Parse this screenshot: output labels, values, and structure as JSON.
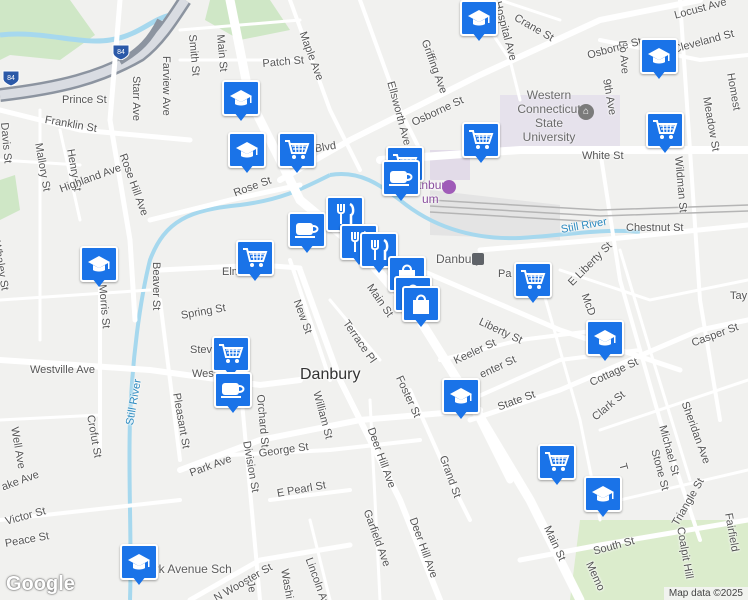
{
  "map": {
    "city_label": "Danbury",
    "attribution": "Map data ©2025",
    "logo": "Google",
    "highway_shield": "84",
    "streets": {
      "locust_ave": "Locust Ave",
      "crane_st": "Crane St",
      "hospital_ave": "Hospital Ave",
      "osborne_st_top": "Osborne St",
      "cleveland_st": "Cleveland St",
      "homestead": "Homest",
      "griffing_ave": "Griffing Ave",
      "lo_ave": "Lo Ave",
      "ninth_ave": "9th Ave",
      "meadow_st": "Meadow St",
      "main_st_top": "Main St",
      "patch_st": "Patch St",
      "smith_st": "Smith St",
      "maple_ave": "Maple Ave",
      "ellsworth_ave": "Ellsworth Ave",
      "osborne_st_mid": "Osborne St",
      "starr_ave": "Starr Ave",
      "farview_ave": "Farview Ave",
      "prince_st": "Prince St",
      "franklin_st": "Franklin St",
      "davis_st": "Davis St",
      "mallory_st": "Mallory St",
      "henry_st": "Henry St",
      "rose_hill_ave": "Rose Hill Ave",
      "highland_ave": "Highland Ave",
      "rose_st": "Rose St",
      "della_blvd": "nella Blvd",
      "white_st": "White St",
      "wildman_st": "Wildman St",
      "chestnut_st": "Chestnut St",
      "whaley_st": "Whaley St",
      "beaver_st": "Beaver St",
      "elm_st": "Elm",
      "morris_st": "Morris St",
      "spring_st": "Spring St",
      "new_st": "New St",
      "terrace_pl": "Terrace Pl",
      "main_st_mid": "Main St",
      "liberty_st": "Liberty St",
      "e_liberty_st": "E Liberty St",
      "pa_ave": "Pa",
      "mcdonald": "McD",
      "keeler_st": "Keeler St",
      "casper_st": "Casper St",
      "tay": "Tay",
      "westville_ave": "Westville Ave",
      "stev": "Stev",
      "west": "Wes",
      "center_st": "enter St",
      "cottage_st": "Cottage St",
      "orchard_st": "Orchard St",
      "william_st": "William St",
      "foster_st": "Foster St",
      "state_st": "State St",
      "clark_st": "Clark St",
      "sheridan_ave": "Sheridan Ave",
      "pleasant_st": "Pleasant St",
      "crofut_st": "Crofut St",
      "well_ave": "Well Ave",
      "park_ave": "Park Ave",
      "division_st": "Division St",
      "george_st": "George St",
      "deer_hill_ave_1": "Deer Hill Ave",
      "grand_st": "Grand St",
      "michael_st": "Michael St",
      "stone_st": "Stone St",
      "t_st": "T",
      "ake_ave": "ake Ave",
      "victor_st": "Victor St",
      "e_pearl_st": "E Pearl St",
      "garfield_ave": "Garfield Ave",
      "deer_hill_ave_2": "Deer Hill Ave",
      "main_st_bottom": "Main St",
      "memo": "Memo",
      "triangle_st": "Triangle St",
      "fairfield": "Fairfield",
      "coalpit_hill": "Coalpit Hill",
      "south_st": "South St",
      "peace_st": "Peace St",
      "n_wooster_st": "N Wooster St",
      "lincoln_ave": "Lincoln Ave",
      "washi": "Washi",
      "je": "Je",
      "jeff_el": "Ri",
      "still_river_1": "Still River",
      "still_river_2": "Still River"
    },
    "pois": {
      "wcsu": "Western Connecticut State University",
      "wcsu_line1": "Western",
      "wcsu_line2": "Connecticut",
      "wcsu_line3": "State",
      "wcsu_line4": "University",
      "danbury_station": "Danbury",
      "museum_partial": "Danbury",
      "museum_partial2": "um",
      "park_ave_school": "Park Avenue Sch"
    },
    "markers": [
      {
        "id": "m1",
        "type": "school"
      },
      {
        "id": "m2",
        "type": "school"
      },
      {
        "id": "m3",
        "type": "school"
      },
      {
        "id": "m4",
        "type": "school"
      },
      {
        "id": "m5",
        "type": "school"
      },
      {
        "id": "m6",
        "type": "school"
      },
      {
        "id": "m7",
        "type": "school"
      },
      {
        "id": "m8",
        "type": "school"
      },
      {
        "id": "m9",
        "type": "school"
      },
      {
        "id": "m10",
        "type": "grocery"
      },
      {
        "id": "m11",
        "type": "grocery"
      },
      {
        "id": "m12",
        "type": "grocery"
      },
      {
        "id": "m13",
        "type": "grocery"
      },
      {
        "id": "m14",
        "type": "grocery"
      },
      {
        "id": "m15",
        "type": "grocery"
      },
      {
        "id": "m16",
        "type": "grocery"
      },
      {
        "id": "m17",
        "type": "grocery"
      },
      {
        "id": "m18",
        "type": "cafe"
      },
      {
        "id": "m19",
        "type": "cafe"
      },
      {
        "id": "m20",
        "type": "cafe"
      },
      {
        "id": "m21",
        "type": "restaurant"
      },
      {
        "id": "m22",
        "type": "restaurant"
      },
      {
        "id": "m23",
        "type": "restaurant"
      },
      {
        "id": "m24",
        "type": "shopping"
      },
      {
        "id": "m25",
        "type": "shopping"
      },
      {
        "id": "m26",
        "type": "shopping"
      }
    ],
    "colors": {
      "road": "#ffffff",
      "background": "#f1f1ef",
      "park": "#cde8c9",
      "water": "#a6d8ee",
      "highway": "#8c94a0",
      "marker": "#1a73e8",
      "campus": "#e8e2ef"
    }
  }
}
